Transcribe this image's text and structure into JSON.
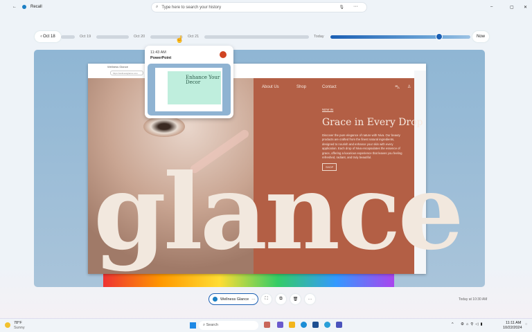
{
  "app": {
    "title": "Recall",
    "window_controls": [
      "minimize",
      "maximize",
      "close"
    ]
  },
  "search": {
    "placeholder": "Type here to search your history"
  },
  "timeline": {
    "back_label": "Oct 18",
    "labels": [
      "Oct 19",
      "Oct 20",
      "Oct 21",
      "Today"
    ],
    "now_label": "Now",
    "position_percent": 88
  },
  "popup": {
    "time": "11:43 AM",
    "app": "PowerPoint",
    "thumb_title": "Enhance Your Decor"
  },
  "browser": {
    "tab": "Wellness Glance",
    "url": "https://wellnessglance.com"
  },
  "site": {
    "nav": [
      "About Us",
      "Shop",
      "Contact"
    ],
    "tag": "NEW IN",
    "headline": "Grace in Every Drop",
    "body": "Discover the pure elegance of nature with Niva. Our beauty products are crafted from the finest natural ingredients, designed to nourish and enhance your skin with every application. Each drop of Niva encapsulates the essence of grace, offering a luxurious experience that leaves you feeling refreshed, radiant, and truly beautiful.",
    "cta": "SHOP",
    "hero_word": "glance"
  },
  "actions": {
    "app_chip": "Wellness Glance",
    "more": "···",
    "timestamp": "Today at 10:30 AM"
  },
  "taskbar": {
    "weather_temp": "78°F",
    "weather_desc": "Sunny",
    "search": "Search",
    "time": "11:11 AM",
    "date": "10/22/2024"
  },
  "colors": {
    "accent": "#1a5fb4",
    "terracotta": "#b35f45"
  }
}
